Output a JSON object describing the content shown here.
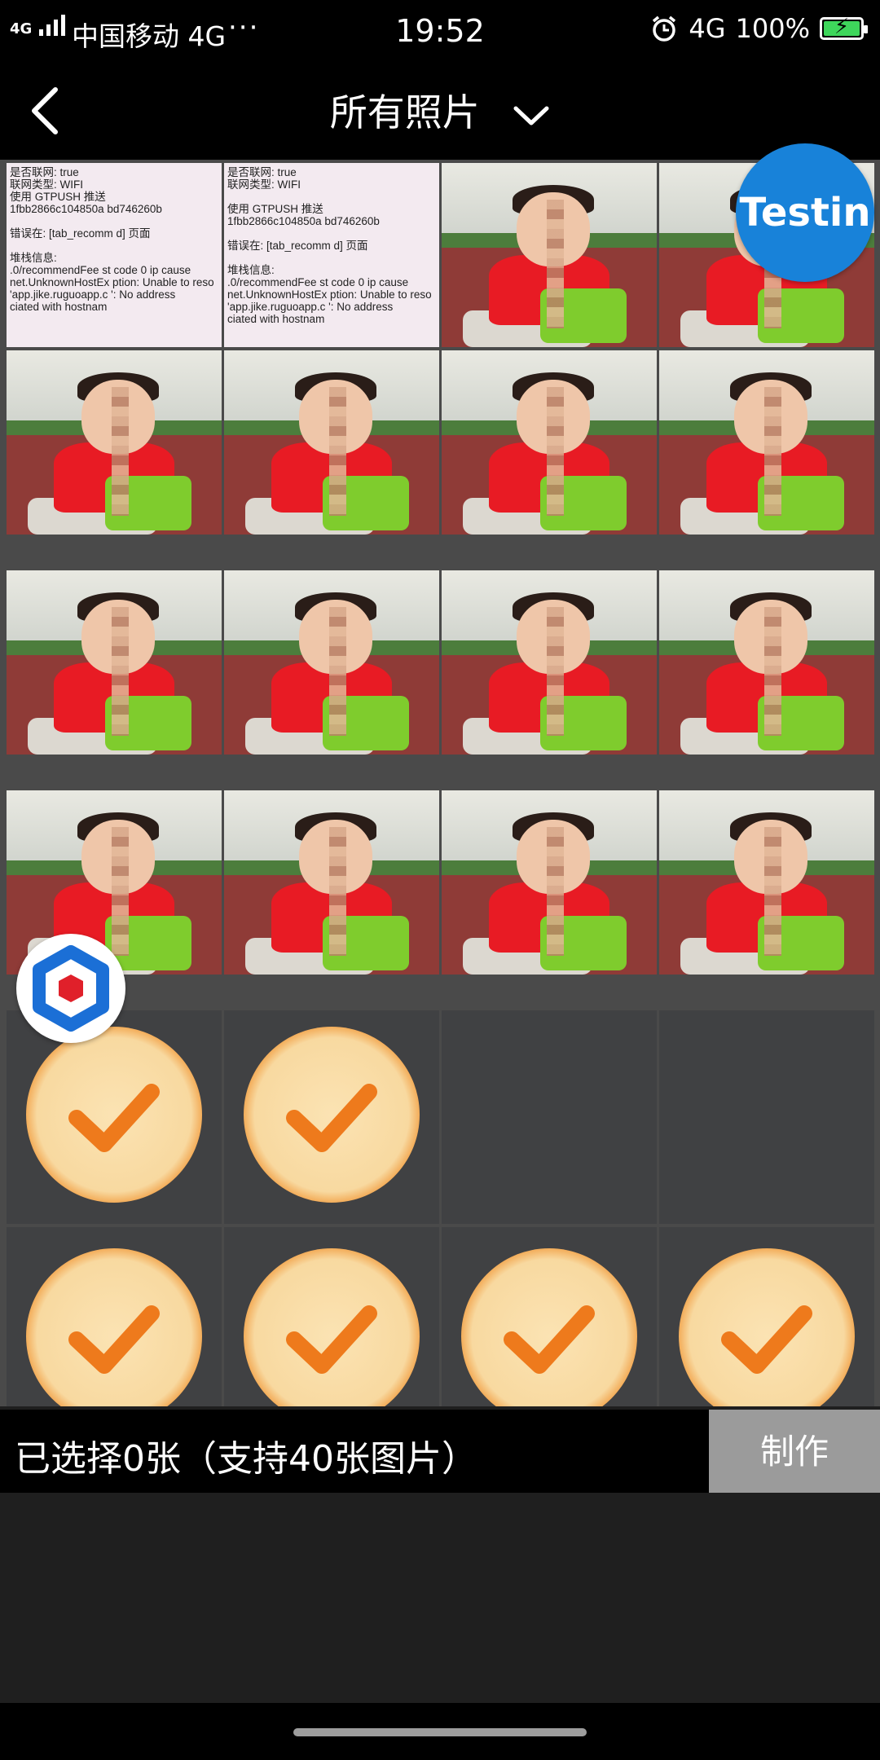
{
  "status_bar": {
    "network_small": "4G",
    "carrier": "中国移动 4G",
    "more": "···",
    "time": "19:52",
    "right_network": "4G",
    "battery": "100%"
  },
  "title_bar": {
    "title": "所有照片"
  },
  "overlays": {
    "testin": "Testin"
  },
  "screenshot_text": [
    "是否联网: true",
    "联网类型: WIFI",
    "",
    "使用 GTPUSH 推送",
    "1fbb2866c104850a   bd746260b",
    "",
    "错误在: [tab_recomm    d] 页面",
    "",
    "堆栈信息:",
    ".0/recommendFee   st code 0 ip  cause",
    "net.UnknownHostEx   ption: Unable to reso",
    "'app.jike.ruguoapp.c   ': No address",
    "ciated with hostnam"
  ],
  "bottom": {
    "selection_info": "已选择0张（支持40张图片）",
    "make_button": "制作"
  },
  "colors": {
    "accent_orange": "#ec7a1e",
    "testin_blue": "#1882d9"
  }
}
